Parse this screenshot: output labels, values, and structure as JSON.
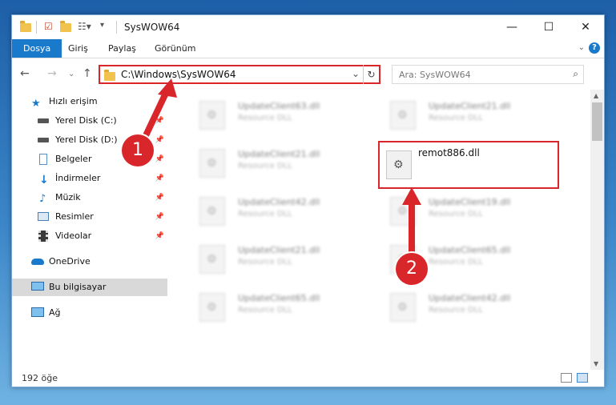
{
  "window": {
    "title": "SysWOW64",
    "controls": {
      "minimize": "—",
      "maximize": "☐",
      "close": "✕"
    }
  },
  "ribbon": {
    "tabs": [
      "Dosya",
      "Giriş",
      "Paylaş",
      "Görünüm"
    ],
    "help": "?"
  },
  "navigation": {
    "back": "←",
    "forward": "→",
    "up": "↑",
    "address": "C:\\Windows\\SysWOW64",
    "search_placeholder": "Ara: SysWOW64"
  },
  "sidebar": {
    "items": [
      {
        "label": "Hızlı erişim",
        "icon": "star-icon",
        "pinned": false
      },
      {
        "label": "Yerel Disk (C:)",
        "icon": "drive-icon",
        "pinned": true
      },
      {
        "label": "Yerel Disk (D:)",
        "icon": "drive-icon",
        "pinned": true
      },
      {
        "label": "Belgeler",
        "icon": "documents-icon",
        "pinned": true
      },
      {
        "label": "İndirmeler",
        "icon": "download-icon",
        "pinned": true
      },
      {
        "label": "Müzik",
        "icon": "music-icon",
        "pinned": true
      },
      {
        "label": "Resimler",
        "icon": "pictures-icon",
        "pinned": true
      },
      {
        "label": "Videolar",
        "icon": "video-icon",
        "pinned": true
      },
      {
        "label": "OneDrive",
        "icon": "cloud-icon",
        "pinned": false
      },
      {
        "label": "Bu bilgisayar",
        "icon": "computer-icon",
        "pinned": false,
        "selected": true
      },
      {
        "label": "Ağ",
        "icon": "network-icon",
        "pinned": false
      }
    ]
  },
  "files": [
    {
      "name": "UpdateClient63.dll",
      "type": "Resource DLL",
      "blurred": true
    },
    {
      "name": "UpdateClient21.dll",
      "type": "Resource DLL",
      "blurred": true
    },
    {
      "name": "UpdateClient21.dll",
      "type": "Resource DLL",
      "blurred": true
    },
    {
      "name": "remot886.dll",
      "type": "",
      "blurred": false,
      "highlighted": true
    },
    {
      "name": "UpdateClient42.dll",
      "type": "Resource DLL",
      "blurred": true
    },
    {
      "name": "UpdateClient19.dll",
      "type": "Resource DLL",
      "blurred": true
    },
    {
      "name": "UpdateClient21.dll",
      "type": "Resource DLL",
      "blurred": true
    },
    {
      "name": "UpdateClient65.dll",
      "type": "Resource DLL",
      "blurred": true
    },
    {
      "name": "UpdateClient65.dll",
      "type": "Resource DLL",
      "blurred": true
    },
    {
      "name": "UpdateClient42.dll",
      "type": "Resource DLL",
      "blurred": true
    }
  ],
  "status": {
    "item_count": "192 öğe"
  },
  "annotations": {
    "marker1": "1",
    "marker2": "2",
    "color": "#d9262a"
  }
}
